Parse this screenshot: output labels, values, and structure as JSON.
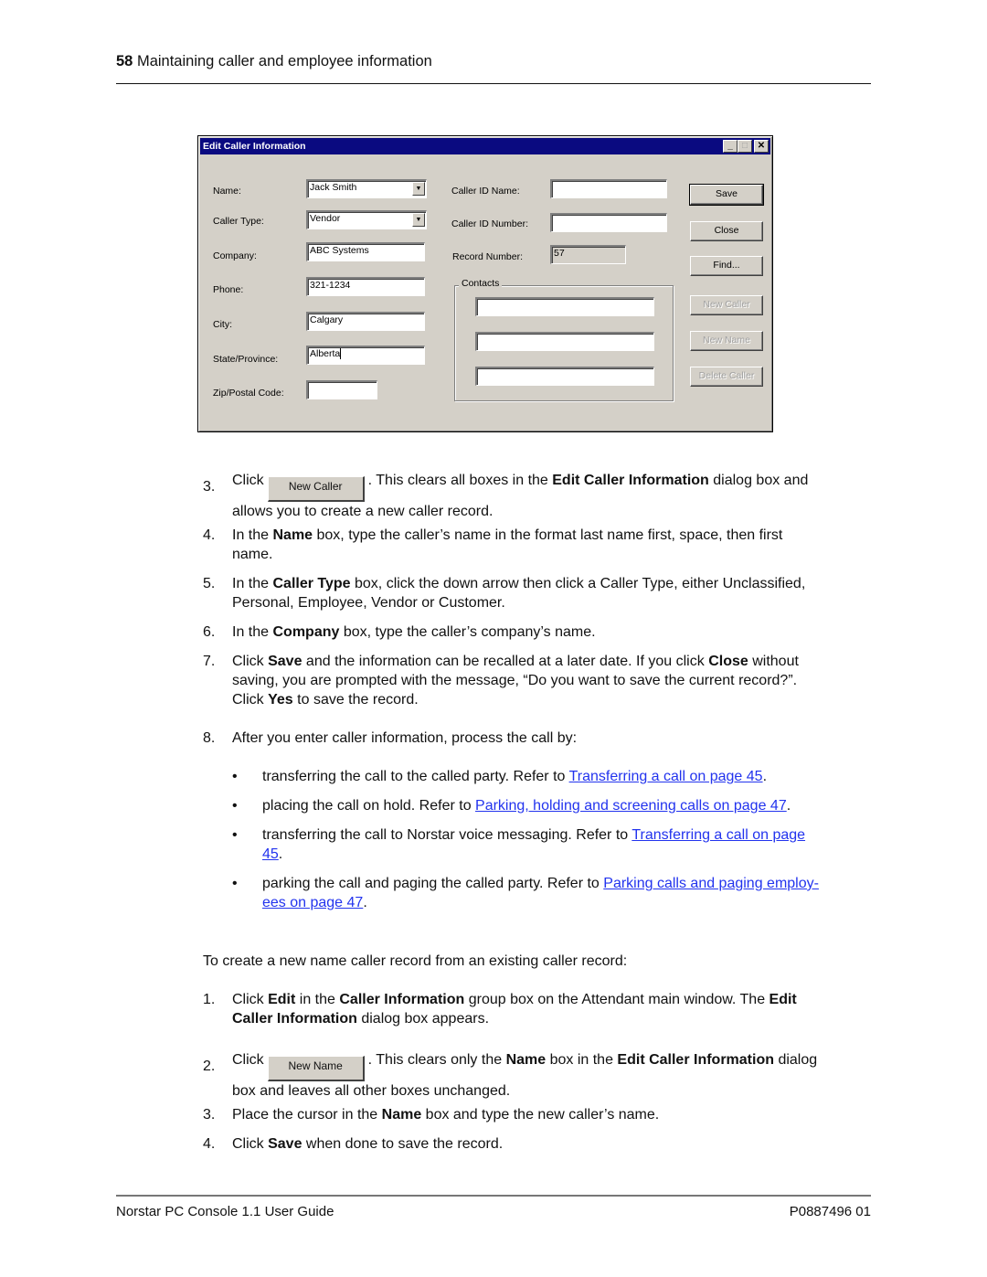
{
  "header": {
    "page_number": "58",
    "title": "Maintaining caller and employee information"
  },
  "dialog": {
    "title": "Edit Caller Information",
    "title_buttons": [
      "minimize",
      "maximize",
      "close"
    ],
    "fields": {
      "name": {
        "label": "Name:",
        "value": "Jack Smith"
      },
      "caller_type": {
        "label": "Caller Type:",
        "value": "Vendor"
      },
      "company": {
        "label": "Company:",
        "value": "ABC Systems"
      },
      "phone": {
        "label": "Phone:",
        "value": "321-1234"
      },
      "city": {
        "label": "City:",
        "value": "Calgary"
      },
      "state": {
        "label": "State/Province:",
        "value": "Alberta"
      },
      "zip": {
        "label": "Zip/Postal Code:",
        "value": ""
      },
      "caller_id_name": {
        "label": "Caller ID Name:",
        "value": ""
      },
      "caller_id_number": {
        "label": "Caller ID Number:",
        "value": ""
      },
      "record_number": {
        "label": "Record Number:",
        "value": "57"
      }
    },
    "contacts": {
      "label": "Contacts",
      "values": [
        "",
        "",
        ""
      ]
    },
    "buttons": {
      "save": "Save",
      "close": "Close",
      "find": "Find...",
      "new_caller": "New Caller",
      "new_name": "New Name",
      "delete_caller": "Delete Caller"
    }
  },
  "steps_a": {
    "s3": {
      "num": "3.",
      "pre": "Click",
      "button": "New Caller",
      "mid": ". This clears all boxes in the ",
      "b1": "Edit Caller Information",
      "post": " dialog box and",
      "line2": "allows you to create a new caller record."
    },
    "s4": {
      "num": "4.",
      "pre": "In the ",
      "b1": "Name",
      "post": " box, type the caller’s name in the format last name first, space, then first",
      "line2": "name."
    },
    "s5": {
      "num": "5.",
      "pre": "In the ",
      "b1": "Caller Type",
      "post": " box, click the down arrow then click a Caller Type, either Unclassified,",
      "line2": "Personal, Employee, Vendor or Customer."
    },
    "s6": {
      "num": "6.",
      "pre": "In the ",
      "b1": "Company",
      "post": " box, type the caller’s company’s name."
    },
    "s7": {
      "num": "7.",
      "pre": "Click ",
      "b1": "Save",
      "mid": " and the information can be recalled at a later date. If you click ",
      "b2": "Close",
      "post": " without",
      "line2": "saving, you are prompted with the message, “Do you want to save the current record?”.",
      "line3_pre": "Click ",
      "line3_b": "Yes",
      "line3_post": " to save the record."
    },
    "s8": {
      "num": "8.",
      "text": "After you enter caller information, process the call by:"
    }
  },
  "bullets": [
    {
      "text": "transferring the call to the called party. Refer to ",
      "link": "Transferring a call on page 45",
      "post": "."
    },
    {
      "text": "placing the call on hold. Refer to ",
      "link": "Parking, holding and screening calls on page 47",
      "post": "."
    },
    {
      "text": "transferring the call to Norstar voice messaging. Refer to ",
      "link": "Transferring a call on page ",
      "link2": "45",
      "post": "."
    },
    {
      "text": "parking the call and paging the called party. Refer to ",
      "link": "Parking calls and paging employ-",
      "link2": "ees on page 47",
      "post": "."
    }
  ],
  "intro_b": "To create a new name caller record from an existing caller record:",
  "steps_b": {
    "s1": {
      "num": "1.",
      "pre": "Click ",
      "b1": "Edit",
      "mid": " in the ",
      "b2": "Caller Information",
      "post": " group box on the Attendant main window. The ",
      "b3": "Edit",
      "line2_b": "Caller Information",
      "line2_post": " dialog box appears."
    },
    "s2": {
      "num": "2.",
      "pre": "Click",
      "button": "New Name",
      "mid": ". This clears only the ",
      "b1": "Name",
      "mid2": " box in the ",
      "b2": "Edit Caller Information",
      "post": " dialog",
      "line2": "box and leaves all other boxes unchanged."
    },
    "s3": {
      "num": "3.",
      "pre": "Place the cursor in the ",
      "b1": "Name",
      "post": " box and type the new caller’s name."
    },
    "s4": {
      "num": "4.",
      "pre": "Click ",
      "b1": "Save",
      "post": " when done to save the record."
    }
  },
  "footer": {
    "left": "Norstar PC Console 1.1 User Guide",
    "right": "P0887496 01"
  }
}
